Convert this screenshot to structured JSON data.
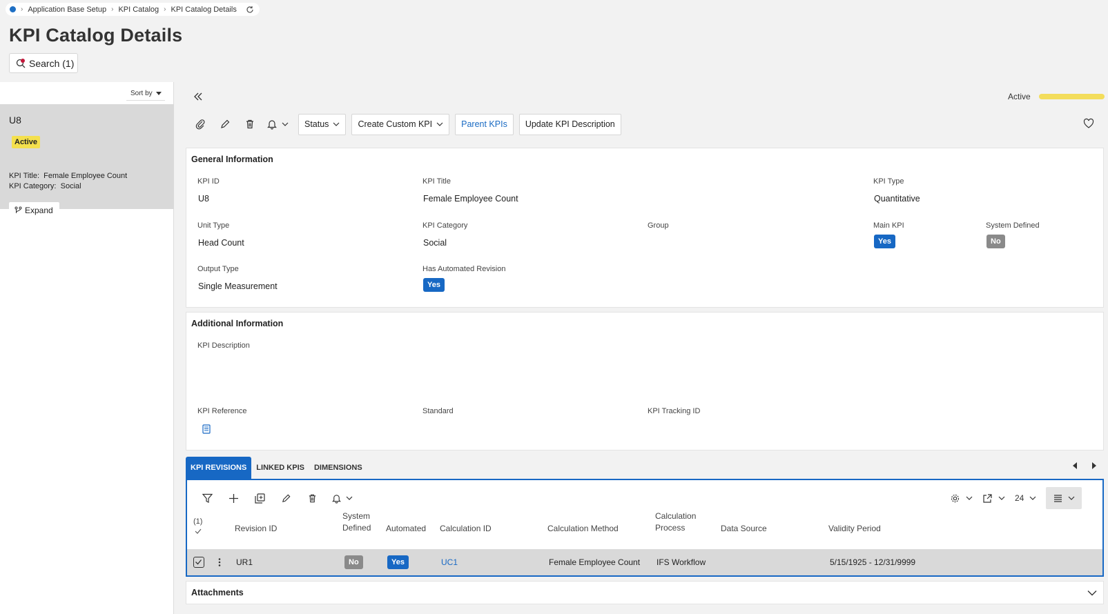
{
  "breadcrumb": {
    "items": [
      "Application Base Setup",
      "KPI Catalog",
      "KPI Catalog Details"
    ]
  },
  "page": {
    "title": "KPI Catalog Details",
    "search_label": "Search (1)"
  },
  "left_panel": {
    "sort_label": "Sort by",
    "card": {
      "id": "U8",
      "status": "Active",
      "title_label": "KPI Title:",
      "title_value": "Female Employee Count",
      "category_label": "KPI Category:",
      "category_value": "Social",
      "expand_label": "Expand"
    }
  },
  "header": {
    "status_text": "Active",
    "status_color": "#f3dd5b"
  },
  "toolbar": {
    "status_label": "Status",
    "create_custom_label": "Create Custom KPI",
    "parent_kpis_label": "Parent KPIs",
    "update_desc_label": "Update KPI Description"
  },
  "general": {
    "title": "General Information",
    "kpi_id_label": "KPI ID",
    "kpi_id": "U8",
    "kpi_title_label": "KPI Title",
    "kpi_title": "Female Employee Count",
    "kpi_type_label": "KPI Type",
    "kpi_type": "Quantitative",
    "unit_type_label": "Unit Type",
    "unit_type": "Head Count",
    "kpi_category_label": "KPI Category",
    "kpi_category": "Social",
    "group_label": "Group",
    "main_kpi_label": "Main KPI",
    "main_kpi": "Yes",
    "system_defined_label": "System Defined",
    "system_defined": "No",
    "output_type_label": "Output Type",
    "output_type": "Single Measurement",
    "automated_revision_label": "Has Automated Revision",
    "automated_revision": "Yes"
  },
  "additional": {
    "title": "Additional Information",
    "desc_label": "KPI Description",
    "reference_label": "KPI Reference",
    "standard_label": "Standard",
    "tracking_label": "KPI Tracking ID"
  },
  "tabs": [
    "KPI REVISIONS",
    "LINKED KPIS",
    "DIMENSIONS"
  ],
  "grid": {
    "page_size": "24",
    "selected_count": "(1)",
    "headers": {
      "revision_id": "Revision ID",
      "system_defined_1": "System",
      "system_defined_2": "Defined",
      "automated": "Automated",
      "calculation_id": "Calculation ID",
      "calculation_method": "Calculation Method",
      "calculation_process_1": "Calculation",
      "calculation_process_2": "Process",
      "data_source": "Data Source",
      "validity_period": "Validity Period"
    },
    "rows": [
      {
        "revision_id": "UR1",
        "system_defined": "No",
        "automated": "Yes",
        "calculation_id": "UC1",
        "calculation_method": "Female Employee Count",
        "calculation_process": "IFS Workflow",
        "data_source": "",
        "validity_period": "5/15/1925 - 12/31/9999"
      }
    ]
  },
  "attachments": {
    "title": "Attachments"
  },
  "colors": {
    "accent": "#1768c4",
    "active_badge": "#f4e04d",
    "no_pill": "#8a8a8a"
  }
}
